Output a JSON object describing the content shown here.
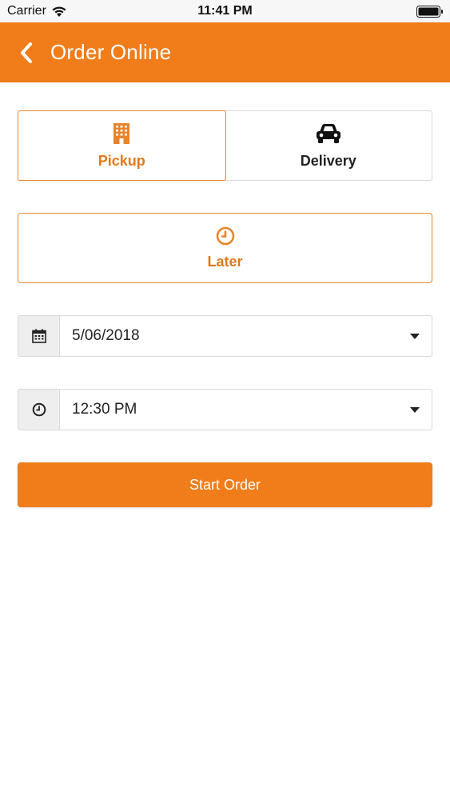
{
  "status_bar": {
    "carrier": "Carrier",
    "time": "11:41 PM"
  },
  "nav": {
    "title": "Order Online"
  },
  "order_type": {
    "options": [
      {
        "label": "Pickup",
        "icon": "building-icon",
        "selected": true
      },
      {
        "label": "Delivery",
        "icon": "car-icon",
        "selected": false
      }
    ]
  },
  "timing": {
    "label": "Later",
    "icon": "clock-icon"
  },
  "date_picker": {
    "value": "5/06/2018",
    "icon": "calendar-icon"
  },
  "time_picker": {
    "value": "12:30 PM",
    "icon": "clock-icon"
  },
  "start_button": {
    "label": "Start Order"
  },
  "colors": {
    "accent": "#f07d1a",
    "accent_text": "#e07a1a"
  }
}
